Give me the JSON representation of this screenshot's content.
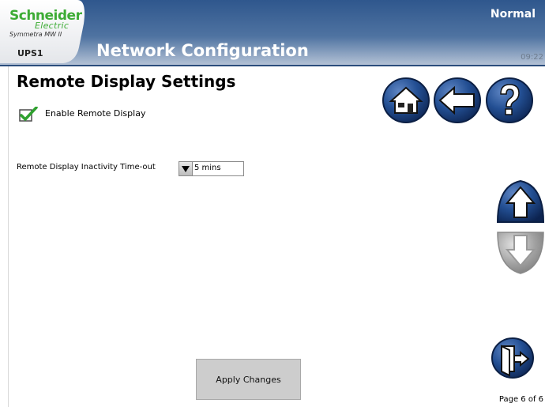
{
  "header": {
    "brand": "Schneider",
    "brand_sub": "Electric",
    "product": "Symmetra MW II",
    "unit": "UPS1",
    "title": "Network Configuration",
    "status": "Normal",
    "clock": "09:22"
  },
  "content": {
    "section_title": "Remote Display Settings",
    "enable_label": "Enable Remote Display",
    "enable_checked": true,
    "timeout_label": "Remote Display Inactivity Time-out",
    "timeout_value": "5 mins"
  },
  "nav": {
    "home_icon": "home-icon",
    "back_icon": "back-arrow-icon",
    "help_icon": "help-icon",
    "scroll_up_icon": "scroll-up-icon",
    "scroll_down_icon": "scroll-down-icon",
    "exit_icon": "exit-door-icon"
  },
  "footer": {
    "apply_label": "Apply Changes",
    "page_indicator": "Page 6 of 6"
  },
  "colors": {
    "brand_green": "#3dac35",
    "header_blue": "#4a6f9e",
    "button_navy": "#1d3f7a"
  }
}
